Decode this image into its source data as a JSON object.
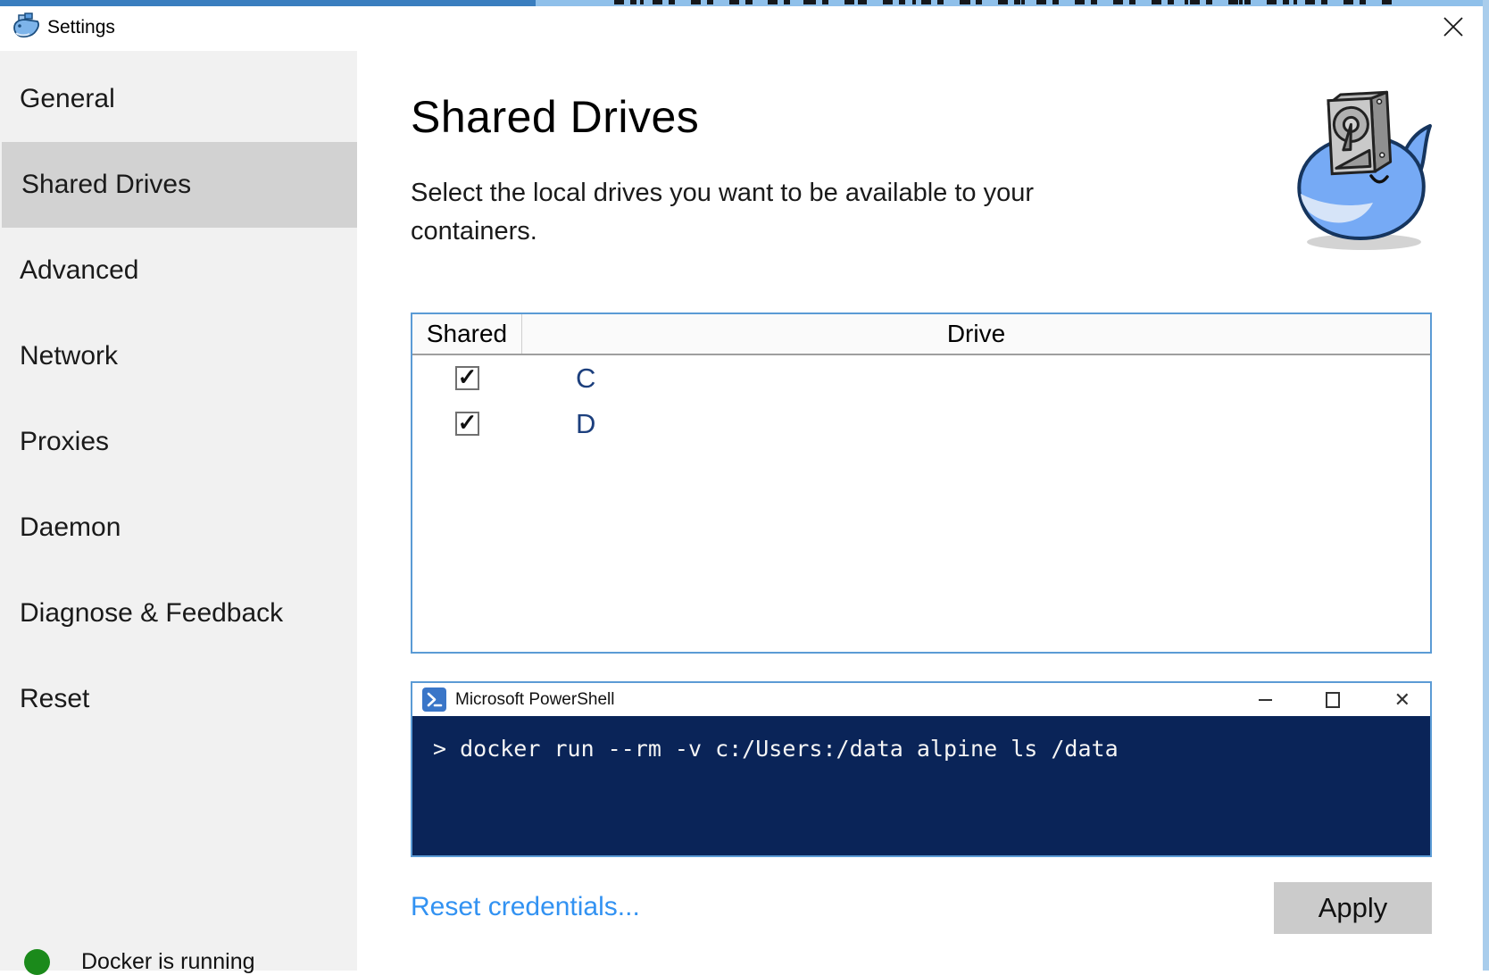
{
  "window": {
    "title": "Settings",
    "close_glyph": "✕"
  },
  "sidebar": {
    "items": [
      {
        "label": "General",
        "selected": false
      },
      {
        "label": "Shared Drives",
        "selected": true
      },
      {
        "label": "Advanced",
        "selected": false
      },
      {
        "label": "Network",
        "selected": false
      },
      {
        "label": "Proxies",
        "selected": false
      },
      {
        "label": "Daemon",
        "selected": false
      },
      {
        "label": "Diagnose & Feedback",
        "selected": false
      },
      {
        "label": "Reset",
        "selected": false
      }
    ],
    "status": {
      "text": "Docker is running",
      "dot_color": "#1b8a1b"
    }
  },
  "main": {
    "title": "Shared Drives",
    "subtitle": "Select the local drives you want to be available to your containers.",
    "table": {
      "columns": [
        "Shared",
        "Drive"
      ],
      "check_glyph": "✓",
      "rows": [
        {
          "shared": true,
          "drive": "C"
        },
        {
          "shared": true,
          "drive": "D"
        }
      ]
    },
    "powershell": {
      "title": "Microsoft PowerShell",
      "command": "> docker run --rm -v c:/Users:/data alpine ls /data",
      "terminal_bg": "#0a2458"
    },
    "reset_link": "Reset credentials...",
    "apply_label": "Apply"
  },
  "colors": {
    "panel_border": "#5b9bd5",
    "sidebar_bg": "#f1f1f1",
    "sidebar_selected": "#d2d2d2",
    "link_blue": "#3292f2",
    "drive_letter_blue": "#1c3f7d",
    "apply_bg": "#cbcbcb",
    "top_strip_light": "#8fc0ea",
    "top_strip_dark": "#3a7ebf"
  }
}
